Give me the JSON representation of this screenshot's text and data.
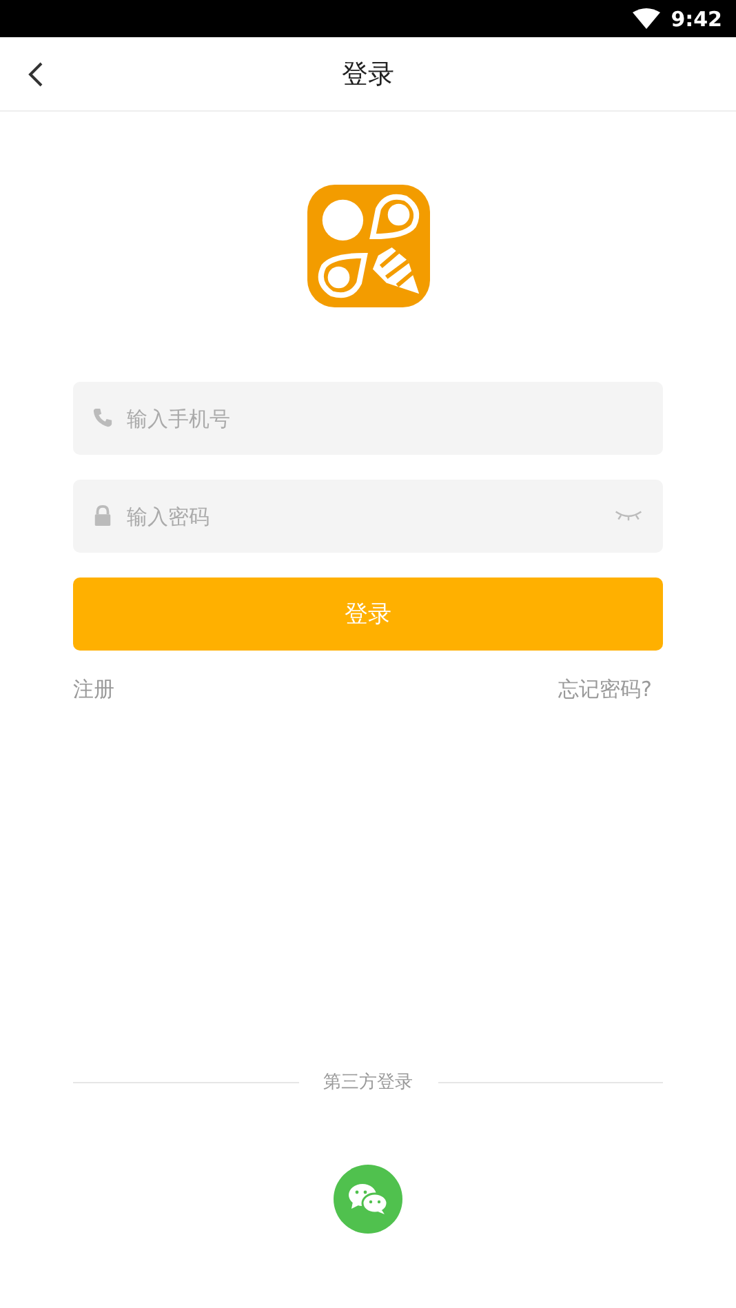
{
  "status_bar": {
    "time": "9:42"
  },
  "header": {
    "title": "登录"
  },
  "phone_field": {
    "placeholder": "输入手机号"
  },
  "password_field": {
    "placeholder": "输入密码"
  },
  "login_button": "登录",
  "register_link": "注册",
  "forgot_link": "忘记密码?",
  "third_party": {
    "label": "第三方登录"
  }
}
